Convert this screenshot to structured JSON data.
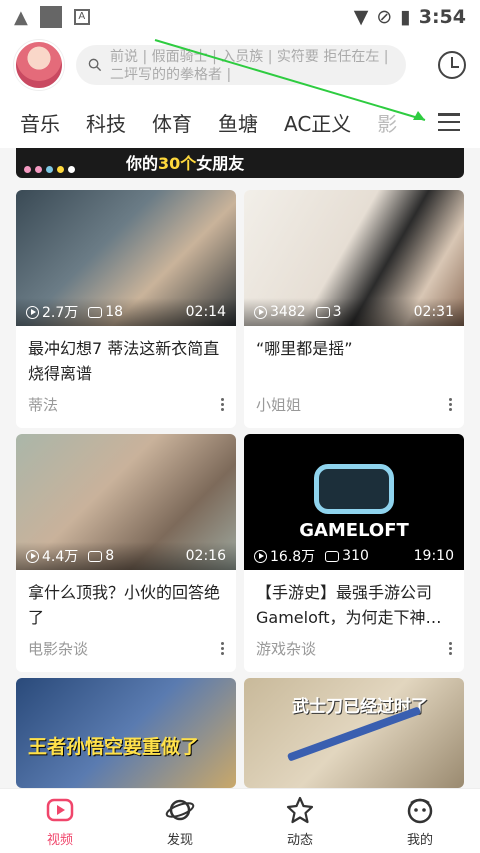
{
  "status_bar": {
    "time": "3:54"
  },
  "header": {
    "search_placeholder": "前说 | 假面骑士 | 入员族 | 实符要 拒任在左 | 二坪写的的拳格者 |",
    "avatar": "avatar-girl"
  },
  "tabs": [
    "音乐",
    "科技",
    "体育",
    "鱼塘",
    "AC正义",
    "影"
  ],
  "banner": {
    "text_prefix": "你的",
    "text_highlight": "30个",
    "text_suffix": "女朋友"
  },
  "cards": [
    {
      "views": "2.7万",
      "danmaku": "18",
      "duration": "02:14",
      "title": "最冲幻想7 蒂法这新衣简直烧得离谱",
      "channel": "蒂法"
    },
    {
      "views": "3482",
      "danmaku": "3",
      "duration": "02:31",
      "title": "“哪里都是摇”",
      "channel": "小姐姐"
    },
    {
      "views": "4.4万",
      "danmaku": "8",
      "duration": "02:16",
      "title": "拿什么顶我？小伙的回答绝了",
      "channel": "电影杂谈"
    },
    {
      "views": "16.8万",
      "danmaku": "310",
      "duration": "19:10",
      "title": "【手游史】最强手游公司Gameloft，为何走下神…",
      "channel": "游戏杂谈",
      "thumb_text": "GAMELOFT"
    },
    {
      "thumb_text": "王者孙悟空要重做了"
    },
    {
      "thumb_text": "武士刀已经过时了"
    }
  ],
  "bottom_nav": [
    {
      "label": "视频",
      "icon": "video-icon",
      "active": true
    },
    {
      "label": "发现",
      "icon": "planet-icon"
    },
    {
      "label": "动态",
      "icon": "star-icon"
    },
    {
      "label": "我的",
      "icon": "profile-icon"
    }
  ],
  "colors": {
    "accent": "#f0466b"
  }
}
